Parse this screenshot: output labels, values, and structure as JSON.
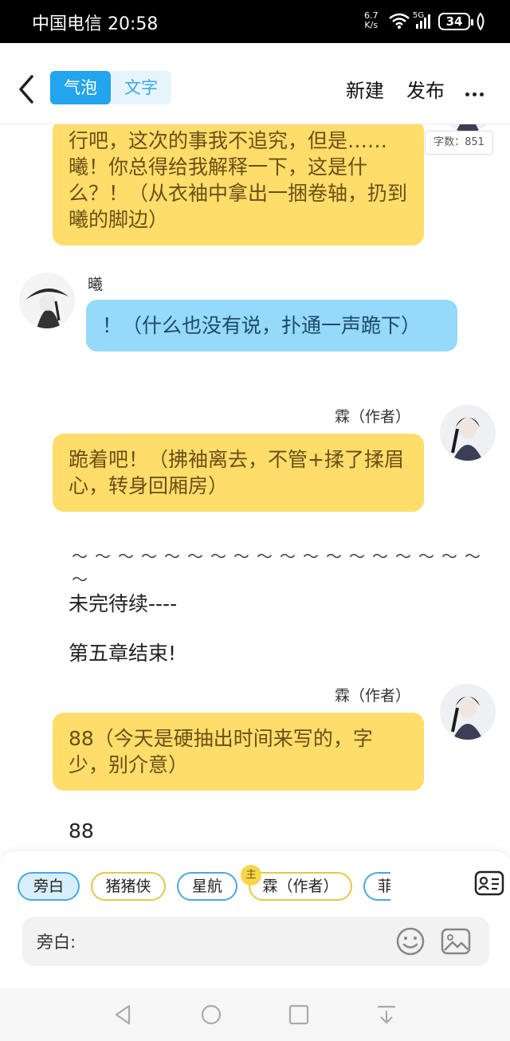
{
  "status": {
    "carrier_time": "中国电信 20:58",
    "speed_top": "6.7",
    "speed_bottom": "K/s",
    "net": "5G",
    "battery": "34"
  },
  "topbar": {
    "tabs": [
      "气泡",
      "文字"
    ],
    "new": "新建",
    "publish": "发布"
  },
  "word_count": "字数：851",
  "messages": {
    "m1": "行吧，这次的事我不追究，但是……曦！你总得给我解释一下，这是什么？！（从衣袖中拿出一捆卷轴，扔到曦的脚边）",
    "m2_name": "曦",
    "m2": "！（什么也没有说，扑通一声跪下）",
    "m3_name": "霖（作者）",
    "m3": "跪着吧！（拂袖离去，不管+揉了揉眉心，转身回厢房）",
    "tilde": "～～～～～～～～～～～～～～～～～～～",
    "plain1": "未完待续----",
    "plain2": "第五章结束!",
    "m4_name": "霖（作者）",
    "m4": "88（今天是硬抽出时间来写的，字少，别介意）",
    "plain3": "88"
  },
  "roles": [
    "旁白",
    "猪猪侠",
    "星航",
    "霖（作者）",
    "菲"
  ],
  "main_badge": "主",
  "input": {
    "label": "旁白:",
    "value": ""
  },
  "icons": [
    "back-icon",
    "more-icon",
    "card-icon",
    "smile-icon",
    "image-icon",
    "nav-back-icon",
    "nav-home-icon",
    "nav-recent-icon",
    "nav-down-icon"
  ]
}
